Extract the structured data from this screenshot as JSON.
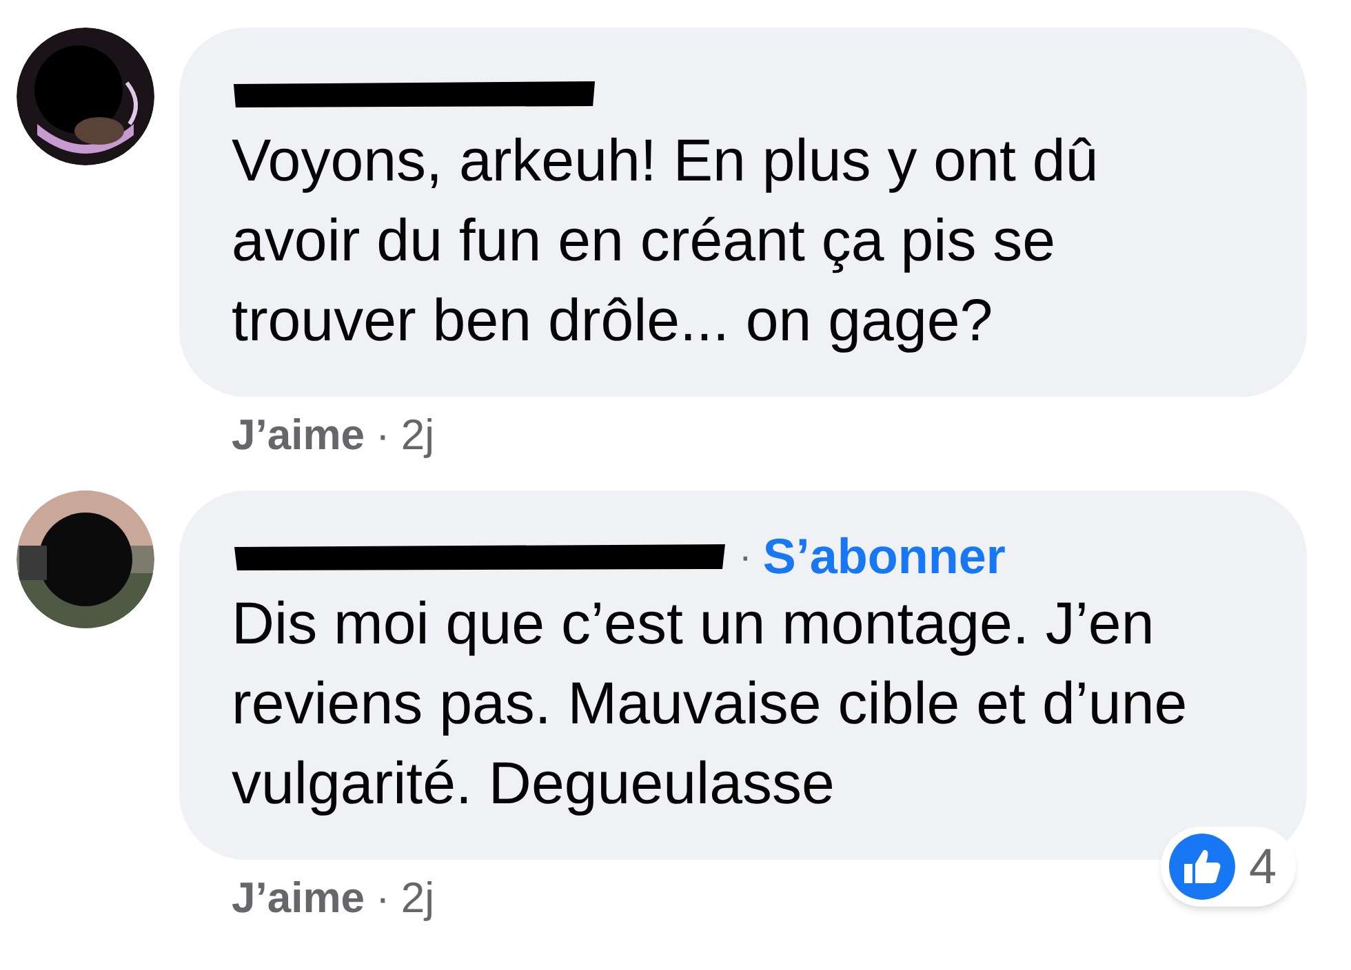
{
  "comments": [
    {
      "text": "Voyons, arkeuh! En plus y ont dû avoir du fun en créant ça pis se trouver ben drôle... on gage?",
      "like_label": "J’aime",
      "separator": "·",
      "time": "2j"
    },
    {
      "name_separator": "·",
      "follow_label": "S’abonner",
      "text": "Dis moi que c’est un montage. J’en reviens pas. Mauvaise cible et d’une vulgarité. Degueulasse",
      "like_label": "J’aime",
      "separator": "·",
      "time": "2j",
      "reactions": "4"
    }
  ]
}
